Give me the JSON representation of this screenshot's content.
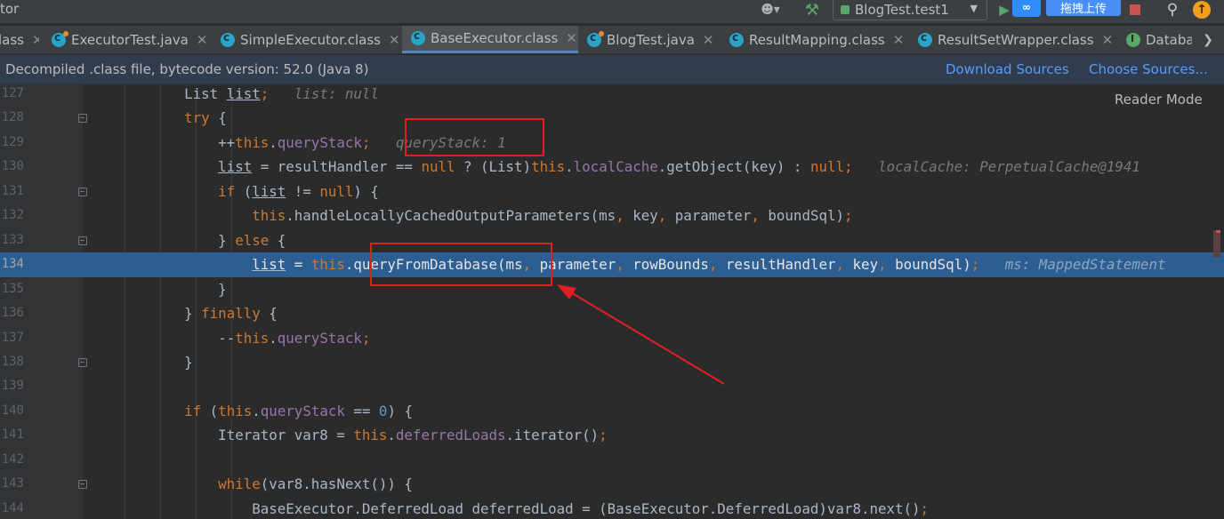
{
  "toolbar": {
    "app_title": "tor",
    "run_config": "BlogTest.test1",
    "upload_label": "拖拽上传",
    "baidu_logo": "∞"
  },
  "tabs": [
    {
      "label": "lass",
      "icon": "none",
      "active": false
    },
    {
      "label": "ExecutorTest.java",
      "icon": "java-class-icon",
      "active": false
    },
    {
      "label": "SimpleExecutor.class",
      "icon": "class-icon",
      "active": false
    },
    {
      "label": "BaseExecutor.class",
      "icon": "class-icon",
      "active": true
    },
    {
      "label": "BlogTest.java",
      "icon": "java-class-icon",
      "active": false
    },
    {
      "label": "ResultMapping.class",
      "icon": "class-icon",
      "active": false
    },
    {
      "label": "ResultSetWrapper.class",
      "icon": "class-icon",
      "active": false
    },
    {
      "label": "Databa",
      "icon": "interface-icon",
      "active": false
    }
  ],
  "banner": {
    "text": "Decompiled .class file, bytecode version: 52.0 (Java 8)",
    "download_sources": "Download Sources",
    "choose_sources": "Choose Sources..."
  },
  "editor": {
    "reader_mode": "Reader Mode",
    "current_line": 134,
    "lines": [
      {
        "n": "127",
        "text": "            List list;   list: null"
      },
      {
        "n": "128",
        "text": "            try {"
      },
      {
        "n": "129",
        "text": "                ++this.queryStack;   queryStack: 1"
      },
      {
        "n": "130",
        "text": "                list = resultHandler == null ? (List)this.localCache.getObject(key) : null;   localCache: PerpetualCache@1941"
      },
      {
        "n": "131",
        "text": "                if (list != null) {"
      },
      {
        "n": "132",
        "text": "                    this.handleLocallyCachedOutputParameters(ms, key, parameter, boundSql);"
      },
      {
        "n": "133",
        "text": "                } else {"
      },
      {
        "n": "134",
        "text": "                    list = this.queryFromDatabase(ms, parameter, rowBounds, resultHandler, key, boundSql);   ms: MappedStatement"
      },
      {
        "n": "135",
        "text": "                }"
      },
      {
        "n": "136",
        "text": "            } finally {"
      },
      {
        "n": "137",
        "text": "                --this.queryStack;"
      },
      {
        "n": "138",
        "text": "            }"
      },
      {
        "n": "139",
        "text": ""
      },
      {
        "n": "140",
        "text": "            if (this.queryStack == 0) {"
      },
      {
        "n": "141",
        "text": "                Iterator var8 = this.deferredLoads.iterator();"
      },
      {
        "n": "142",
        "text": ""
      },
      {
        "n": "143",
        "text": "                while(var8.hasNext()) {"
      },
      {
        "n": "144",
        "text": "                    BaseExecutor.DeferredLoad deferredLoad = (BaseExecutor.DeferredLoad)var8.next();"
      }
    ]
  },
  "colors": {
    "keyword": "#cc7832",
    "field": "#9876aa",
    "number": "#6897bb",
    "hint": "#787878",
    "current_line": "#2d5e92",
    "annotation": "#e02020"
  },
  "icons": [
    "user-icon",
    "build-hammer-icon",
    "run-icon",
    "baidu-netdisk-icon",
    "stop-icon",
    "search-icon",
    "update-icon",
    "chevron-down-icon",
    "close-icon",
    "fold-icon"
  ]
}
